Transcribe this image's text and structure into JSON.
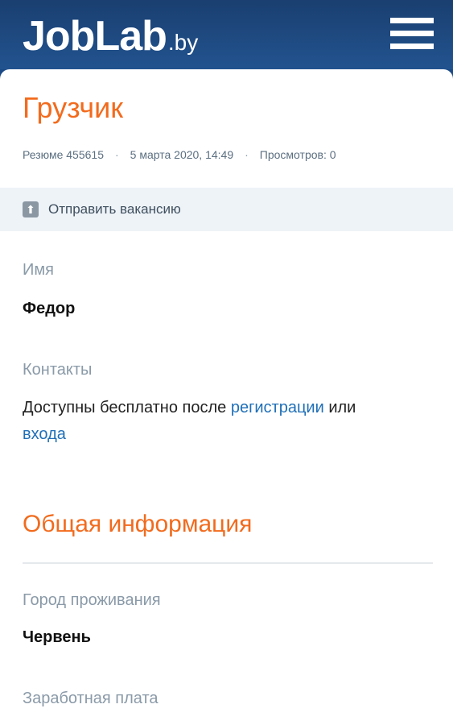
{
  "header": {
    "logo_main": "JobLab",
    "logo_tld": ".by",
    "menu_icon": "hamburger-menu-icon"
  },
  "resume": {
    "title": "Грузчик",
    "id_text": "Резюме 455615",
    "date_text": "5 марта 2020, 14:49",
    "views_text": "Просмотров: 0",
    "separator": "·"
  },
  "share": {
    "icon": "upload-arrow-icon",
    "icon_glyph": "⬆",
    "label": "Отправить вакансию"
  },
  "fields": {
    "name_label": "Имя",
    "name_value": "Федор",
    "contacts_label": "Контакты",
    "contacts_prefix": "Доступны бесплатно после",
    "contacts_link_register": "регистрации",
    "contacts_or": "или",
    "contacts_link_login": "входа"
  },
  "general": {
    "title": "Общая информация",
    "city_label": "Город проживания",
    "city_value": "Червень",
    "salary_label": "Заработная плата"
  },
  "colors": {
    "accent": "#f26b1d",
    "header": "#22538f",
    "link": "#1f6fb8"
  }
}
